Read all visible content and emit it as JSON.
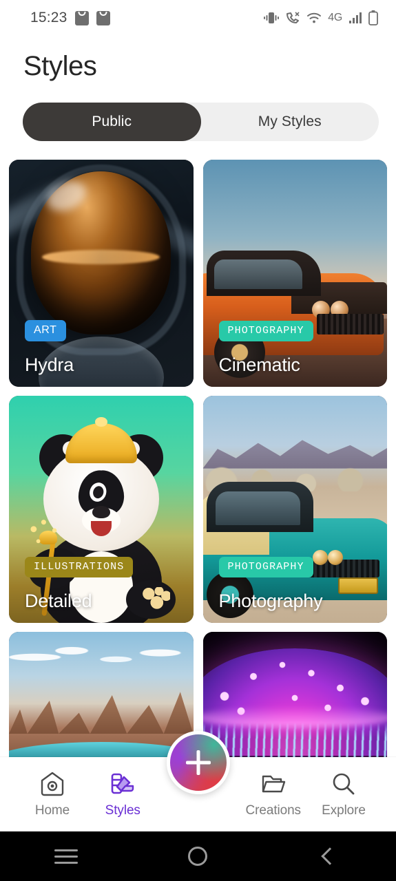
{
  "status_bar": {
    "time": "15:23",
    "left_icons": [
      "inbox-icon",
      "inbox-icon"
    ],
    "right_icons": [
      "vibrate-icon",
      "call-icon",
      "wifi-icon",
      "signal-icon",
      "battery-icon"
    ],
    "network_label": "4G"
  },
  "header": {
    "title": "Styles"
  },
  "tabs": [
    {
      "label": "Public",
      "active": true
    },
    {
      "label": "My Styles",
      "active": false
    }
  ],
  "colors": {
    "badge_art": "#2b90df",
    "badge_photography": "#28c9a8",
    "badge_illustrations": "#9b8719",
    "tab_active_bg": "#3d3a38",
    "tab_track_bg": "#efefef",
    "nav_active": "#6a2fd4",
    "nav_inactive": "#7b7b7b"
  },
  "cards": [
    {
      "title": "Hydra",
      "badge": "ART",
      "badge_color": "#2b90df",
      "art": "astronaut-helmet"
    },
    {
      "title": "Cinematic",
      "badge": "PHOTOGRAPHY",
      "badge_color": "#28c9a8",
      "art": "orange-muscle-car"
    },
    {
      "title": "Detailed",
      "badge": "ILLUSTRATIONS",
      "badge_color": "#9b8719",
      "art": "cartoon-panda"
    },
    {
      "title": "Photography",
      "badge": "PHOTOGRAPHY",
      "badge_color": "#28c9a8",
      "art": "teal-classic-car"
    },
    {
      "title": "",
      "badge": "",
      "badge_color": "",
      "art": "desert-mesa-car"
    },
    {
      "title": "",
      "badge": "",
      "badge_color": "",
      "art": "neon-purple-dome"
    }
  ],
  "bottom_nav": {
    "items": [
      {
        "label": "Home",
        "icon": "home-camera-icon",
        "active": false
      },
      {
        "label": "Styles",
        "icon": "palette-icon",
        "active": true
      },
      {
        "label": "Creations",
        "icon": "folder-icon",
        "active": false
      },
      {
        "label": "Explore",
        "icon": "search-icon",
        "active": false
      }
    ],
    "fab": {
      "icon": "plus-icon"
    }
  },
  "android_nav": {
    "buttons": [
      "recents-icon",
      "home-circle-icon",
      "back-icon"
    ]
  }
}
